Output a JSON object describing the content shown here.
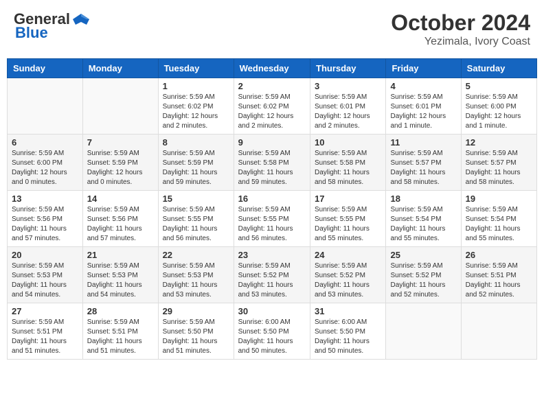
{
  "header": {
    "logo_line1": "General",
    "logo_line2": "Blue",
    "month": "October 2024",
    "location": "Yezimala, Ivory Coast"
  },
  "weekdays": [
    "Sunday",
    "Monday",
    "Tuesday",
    "Wednesday",
    "Thursday",
    "Friday",
    "Saturday"
  ],
  "weeks": [
    [
      {
        "day": "",
        "info": ""
      },
      {
        "day": "",
        "info": ""
      },
      {
        "day": "1",
        "info": "Sunrise: 5:59 AM\nSunset: 6:02 PM\nDaylight: 12 hours\nand 2 minutes."
      },
      {
        "day": "2",
        "info": "Sunrise: 5:59 AM\nSunset: 6:02 PM\nDaylight: 12 hours\nand 2 minutes."
      },
      {
        "day": "3",
        "info": "Sunrise: 5:59 AM\nSunset: 6:01 PM\nDaylight: 12 hours\nand 2 minutes."
      },
      {
        "day": "4",
        "info": "Sunrise: 5:59 AM\nSunset: 6:01 PM\nDaylight: 12 hours\nand 1 minute."
      },
      {
        "day": "5",
        "info": "Sunrise: 5:59 AM\nSunset: 6:00 PM\nDaylight: 12 hours\nand 1 minute."
      }
    ],
    [
      {
        "day": "6",
        "info": "Sunrise: 5:59 AM\nSunset: 6:00 PM\nDaylight: 12 hours\nand 0 minutes."
      },
      {
        "day": "7",
        "info": "Sunrise: 5:59 AM\nSunset: 5:59 PM\nDaylight: 12 hours\nand 0 minutes."
      },
      {
        "day": "8",
        "info": "Sunrise: 5:59 AM\nSunset: 5:59 PM\nDaylight: 11 hours\nand 59 minutes."
      },
      {
        "day": "9",
        "info": "Sunrise: 5:59 AM\nSunset: 5:58 PM\nDaylight: 11 hours\nand 59 minutes."
      },
      {
        "day": "10",
        "info": "Sunrise: 5:59 AM\nSunset: 5:58 PM\nDaylight: 11 hours\nand 58 minutes."
      },
      {
        "day": "11",
        "info": "Sunrise: 5:59 AM\nSunset: 5:57 PM\nDaylight: 11 hours\nand 58 minutes."
      },
      {
        "day": "12",
        "info": "Sunrise: 5:59 AM\nSunset: 5:57 PM\nDaylight: 11 hours\nand 58 minutes."
      }
    ],
    [
      {
        "day": "13",
        "info": "Sunrise: 5:59 AM\nSunset: 5:56 PM\nDaylight: 11 hours\nand 57 minutes."
      },
      {
        "day": "14",
        "info": "Sunrise: 5:59 AM\nSunset: 5:56 PM\nDaylight: 11 hours\nand 57 minutes."
      },
      {
        "day": "15",
        "info": "Sunrise: 5:59 AM\nSunset: 5:55 PM\nDaylight: 11 hours\nand 56 minutes."
      },
      {
        "day": "16",
        "info": "Sunrise: 5:59 AM\nSunset: 5:55 PM\nDaylight: 11 hours\nand 56 minutes."
      },
      {
        "day": "17",
        "info": "Sunrise: 5:59 AM\nSunset: 5:55 PM\nDaylight: 11 hours\nand 55 minutes."
      },
      {
        "day": "18",
        "info": "Sunrise: 5:59 AM\nSunset: 5:54 PM\nDaylight: 11 hours\nand 55 minutes."
      },
      {
        "day": "19",
        "info": "Sunrise: 5:59 AM\nSunset: 5:54 PM\nDaylight: 11 hours\nand 55 minutes."
      }
    ],
    [
      {
        "day": "20",
        "info": "Sunrise: 5:59 AM\nSunset: 5:53 PM\nDaylight: 11 hours\nand 54 minutes."
      },
      {
        "day": "21",
        "info": "Sunrise: 5:59 AM\nSunset: 5:53 PM\nDaylight: 11 hours\nand 54 minutes."
      },
      {
        "day": "22",
        "info": "Sunrise: 5:59 AM\nSunset: 5:53 PM\nDaylight: 11 hours\nand 53 minutes."
      },
      {
        "day": "23",
        "info": "Sunrise: 5:59 AM\nSunset: 5:52 PM\nDaylight: 11 hours\nand 53 minutes."
      },
      {
        "day": "24",
        "info": "Sunrise: 5:59 AM\nSunset: 5:52 PM\nDaylight: 11 hours\nand 53 minutes."
      },
      {
        "day": "25",
        "info": "Sunrise: 5:59 AM\nSunset: 5:52 PM\nDaylight: 11 hours\nand 52 minutes."
      },
      {
        "day": "26",
        "info": "Sunrise: 5:59 AM\nSunset: 5:51 PM\nDaylight: 11 hours\nand 52 minutes."
      }
    ],
    [
      {
        "day": "27",
        "info": "Sunrise: 5:59 AM\nSunset: 5:51 PM\nDaylight: 11 hours\nand 51 minutes."
      },
      {
        "day": "28",
        "info": "Sunrise: 5:59 AM\nSunset: 5:51 PM\nDaylight: 11 hours\nand 51 minutes."
      },
      {
        "day": "29",
        "info": "Sunrise: 5:59 AM\nSunset: 5:50 PM\nDaylight: 11 hours\nand 51 minutes."
      },
      {
        "day": "30",
        "info": "Sunrise: 6:00 AM\nSunset: 5:50 PM\nDaylight: 11 hours\nand 50 minutes."
      },
      {
        "day": "31",
        "info": "Sunrise: 6:00 AM\nSunset: 5:50 PM\nDaylight: 11 hours\nand 50 minutes."
      },
      {
        "day": "",
        "info": ""
      },
      {
        "day": "",
        "info": ""
      }
    ]
  ]
}
